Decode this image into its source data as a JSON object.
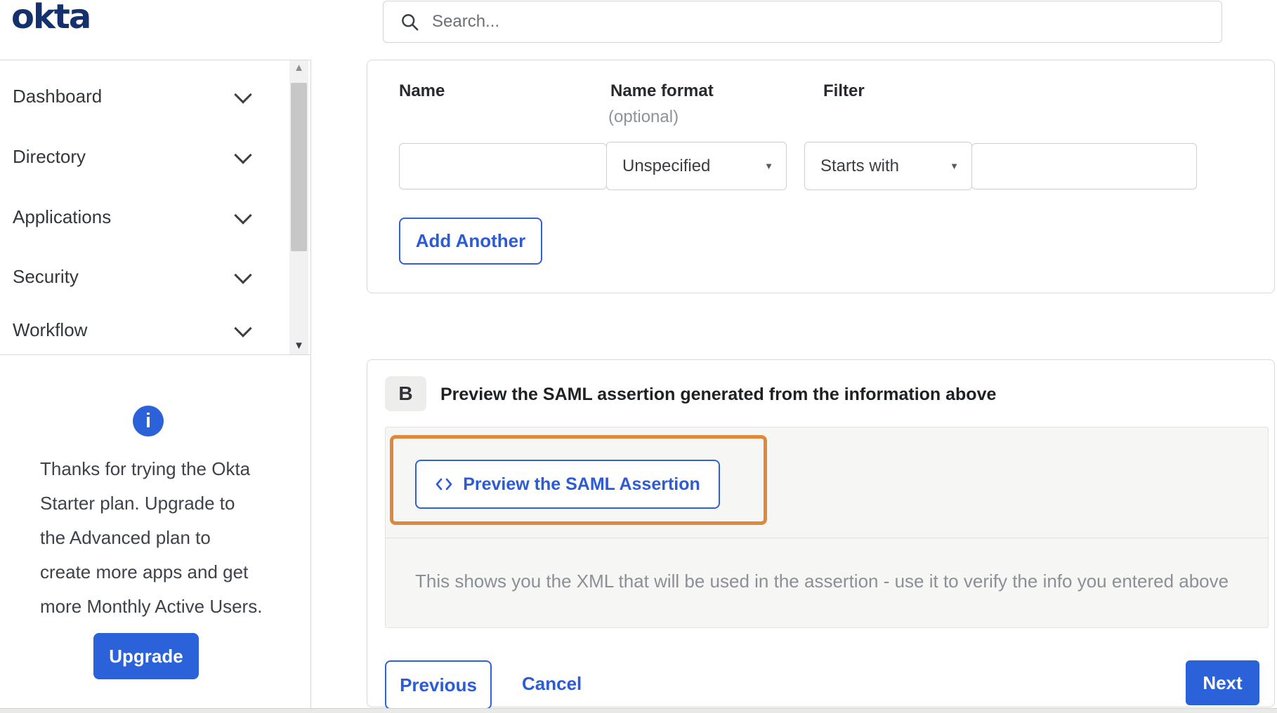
{
  "brand": {
    "logo_text": "okta"
  },
  "search": {
    "placeholder": "Search..."
  },
  "sidebar": {
    "items": [
      {
        "label": "Dashboard"
      },
      {
        "label": "Directory"
      },
      {
        "label": "Applications"
      },
      {
        "label": "Security"
      },
      {
        "label": "Workflow"
      }
    ],
    "upsell": {
      "icon": "info-icon",
      "icon_glyph": "i",
      "text": "Thanks for trying the Okta Starter plan. Upgrade to the Advanced plan to create more apps and get more Monthly Active Users.",
      "lines": [
        "Thanks for trying the Okta",
        "Starter plan. Upgrade to",
        "the Advanced plan to",
        "create more apps and get",
        "more Monthly Active Users."
      ],
      "button": "Upgrade"
    }
  },
  "attribute_form": {
    "labels": {
      "name": "Name",
      "name_format": "Name format",
      "name_format_note": "(optional)",
      "filter": "Filter"
    },
    "name_value": "",
    "name_format_selected": "Unspecified",
    "filter_operator_selected": "Starts with",
    "filter_value": "",
    "add_another": "Add Another"
  },
  "section_b": {
    "badge": "B",
    "heading": "Preview the SAML assertion generated from the information above",
    "preview_button": "Preview the SAML Assertion",
    "description": "This shows you the XML that will be used in the assertion - use it to verify the info you entered above"
  },
  "footer": {
    "previous": "Previous",
    "cancel": "Cancel",
    "next": "Next"
  },
  "colors": {
    "primary_blue": "#2b61d9",
    "logo_navy": "#15316d",
    "highlight_orange": "#e0883a",
    "border_gray": "#d9d9d9",
    "panel_gray": "#f6f6f4"
  }
}
